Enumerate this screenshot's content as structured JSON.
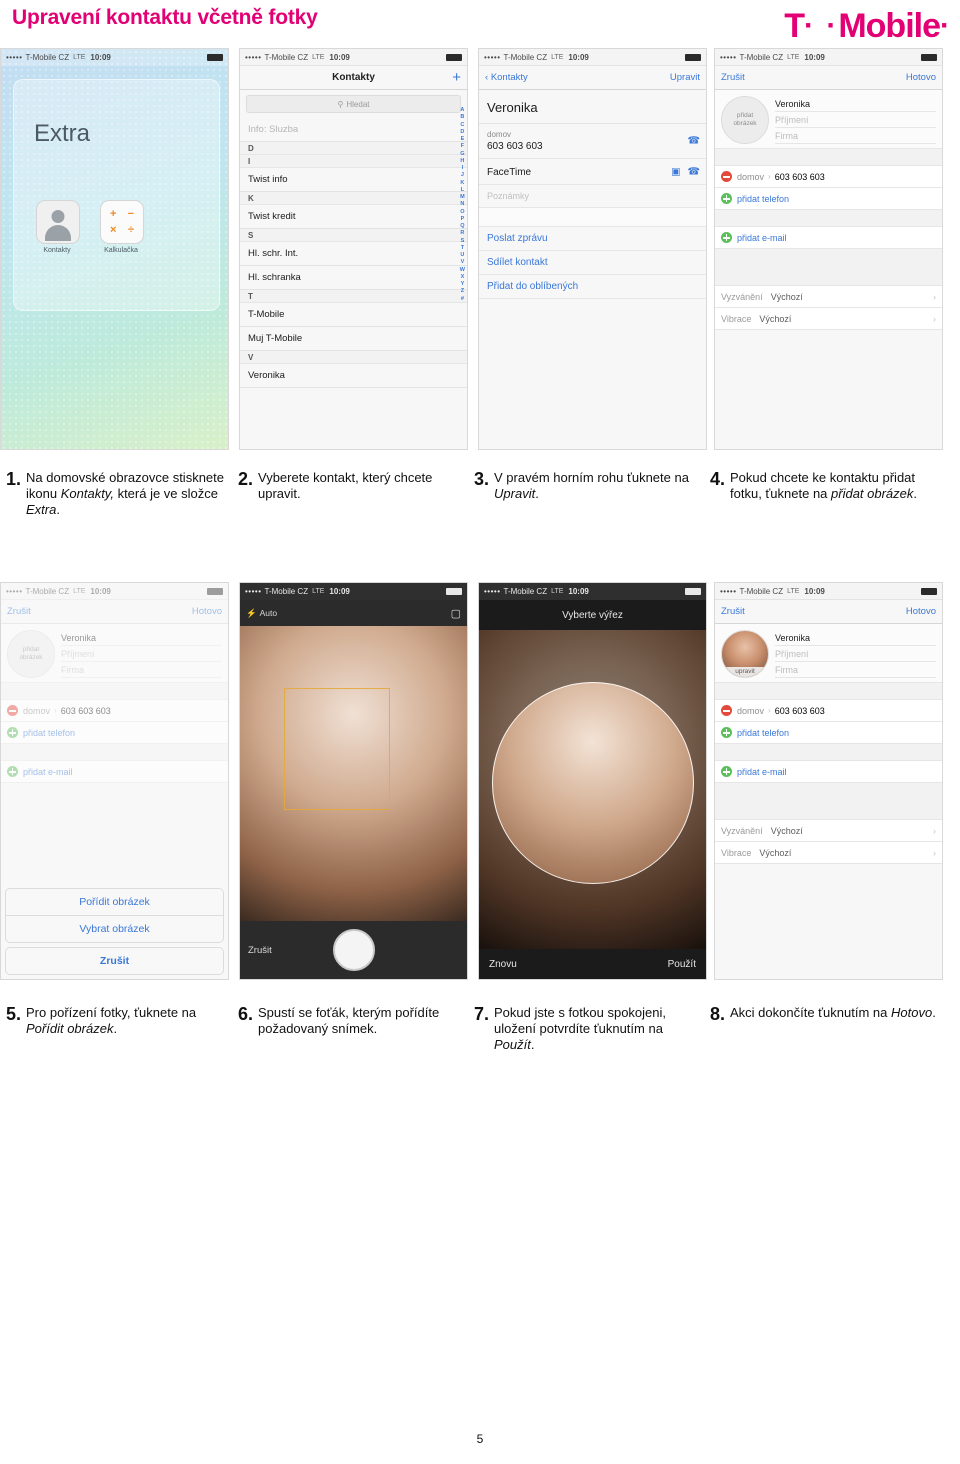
{
  "header": {
    "title": "Upravení kontaktu včetně fotky",
    "logo_text": "T",
    "logo_dots": "· ·",
    "logo_text2": "Mobile",
    "logo_dots2": "·",
    "brand_color": "#e20074"
  },
  "status_bar": {
    "dots": "•••••",
    "carrier": "T-Mobile CZ",
    "network": "LTE",
    "time": "10:09"
  },
  "screens": {
    "s1_home": {
      "folder_label": "Extra",
      "apps": [
        {
          "name": "Kontakty"
        },
        {
          "name": "Kalkulačka"
        }
      ]
    },
    "s2_contacts": {
      "nav_title": "Kontakty",
      "nav_add": "+",
      "search_placeholder": "Hledat",
      "search_icon": "search-icon",
      "rows": [
        {
          "label": "Info: Sluzba",
          "type": "faded"
        },
        {
          "label": "D",
          "type": "letter"
        },
        {
          "label": "I",
          "type": "letter"
        },
        {
          "label": "Twist info",
          "type": "item"
        },
        {
          "label": "K",
          "type": "letter"
        },
        {
          "label": "Twist kredit",
          "type": "item"
        },
        {
          "label": "S",
          "type": "letter"
        },
        {
          "label": "Hl. schr. Int.",
          "type": "item"
        },
        {
          "label": "Hl. schranka",
          "type": "item"
        },
        {
          "label": "T",
          "type": "letter"
        },
        {
          "label": "T-Mobile",
          "type": "item"
        },
        {
          "label": "Muj T-Mobile",
          "type": "item"
        },
        {
          "label": "V",
          "type": "letter"
        },
        {
          "label": "Veronika",
          "type": "item"
        }
      ],
      "alpha_index": [
        "A",
        "B",
        "C",
        "D",
        "E",
        "F",
        "G",
        "H",
        "I",
        "J",
        "K",
        "L",
        "M",
        "N",
        "O",
        "P",
        "Q",
        "R",
        "S",
        "T",
        "U",
        "V",
        "W",
        "X",
        "Y",
        "Z",
        "#"
      ]
    },
    "s3_detail": {
      "nav_back": "Kontakty",
      "nav_edit": "Upravit",
      "name": "Veronika",
      "phone_label": "domov",
      "phone_value": "603 603 603",
      "facetime_label": "FaceTime",
      "notes_label": "Poznámky",
      "actions": [
        "Poslat zprávu",
        "Sdílet kontakt",
        "Přidat do oblíbených"
      ]
    },
    "s4_edit": {
      "nav_cancel": "Zrušit",
      "nav_done": "Hotovo",
      "photo_label": "přidat\nobrázek",
      "first_name": "Veronika",
      "last_name_ph": "Příjmení",
      "company_ph": "Firma",
      "phone_label": "domov",
      "phone_value": "603 603 603",
      "add_phone": "přidat telefon",
      "add_email": "přidat e-mail",
      "ringtone_label": "Vyzvánění",
      "ringtone_value": "Výchozí",
      "vibration_label": "Vibrace",
      "vibration_value": "Výchozí"
    },
    "s5_sheet": {
      "nav_cancel": "Zrušit",
      "nav_done": "Hotovo",
      "photo_label": "přidat\nobrázek",
      "first_name": "Veronika",
      "last_name_ph": "Příjmení",
      "company_ph": "Firma",
      "phone_label": "domov",
      "phone_value": "603 603 603",
      "add_phone": "přidat telefon",
      "add_email": "přidat e-mail",
      "sheet_take": "Pořídit obrázek",
      "sheet_choose": "Vybrat obrázek",
      "sheet_cancel": "Zrušit"
    },
    "s6_camera": {
      "flash_label": "Auto",
      "flash_icon": "bolt-icon",
      "switch_icon": "camera-switch-icon",
      "shutter_icon": "shutter-button",
      "cancel": "Zrušit"
    },
    "s7_crop": {
      "title": "Vyberte výřez",
      "retake": "Znovu",
      "use": "Použít"
    },
    "s8_done": {
      "nav_cancel": "Zrušit",
      "nav_done": "Hotovo",
      "photo_edit_label": "upravit",
      "first_name": "Veronika",
      "last_name_ph": "Příjmení",
      "company_ph": "Firma",
      "phone_label": "domov",
      "phone_value": "603 603 603",
      "add_phone": "přidat telefon",
      "add_email": "přidat e-mail",
      "ringtone_label": "Vyzvánění",
      "ringtone_value": "Výchozí",
      "vibration_label": "Vibrace",
      "vibration_value": "Výchozí"
    }
  },
  "steps": [
    {
      "num": "1.",
      "pre": "Na domovské obrazovce stisknete ikonu ",
      "em1": "Kontakty,",
      "mid": " která je ve složce ",
      "em2": "Extra",
      "post": "."
    },
    {
      "num": "2.",
      "pre": "Vyberete kontakt, který chcete upravit.",
      "em1": "",
      "mid": "",
      "em2": "",
      "post": ""
    },
    {
      "num": "3.",
      "pre": "V pravém horním rohu ťuknete na ",
      "em1": "Upravit",
      "mid": "",
      "em2": "",
      "post": "."
    },
    {
      "num": "4.",
      "pre": "Pokud chcete ke kontaktu přidat fotku, ťuknete na ",
      "em1": "přidat obrázek",
      "mid": "",
      "em2": "",
      "post": "."
    },
    {
      "num": "5.",
      "pre": "Pro pořízení fotky, ťuknete na ",
      "em1": "Pořídit obrázek",
      "mid": "",
      "em2": "",
      "post": "."
    },
    {
      "num": "6.",
      "pre": "Spustí se foťák, kterým pořídíte požadovaný snímek.",
      "em1": "",
      "mid": "",
      "em2": "",
      "post": ""
    },
    {
      "num": "7.",
      "pre": "Pokud jste s fotkou spokojeni, uložení potvrdíte ťuknutím na ",
      "em1": "Použít",
      "mid": "",
      "em2": "",
      "post": "."
    },
    {
      "num": "8.",
      "pre": "Akci dokončíte ťuknutím na ",
      "em1": "Hotovo",
      "mid": "",
      "em2": "",
      "post": "."
    }
  ],
  "footer": {
    "page_number": "5"
  }
}
